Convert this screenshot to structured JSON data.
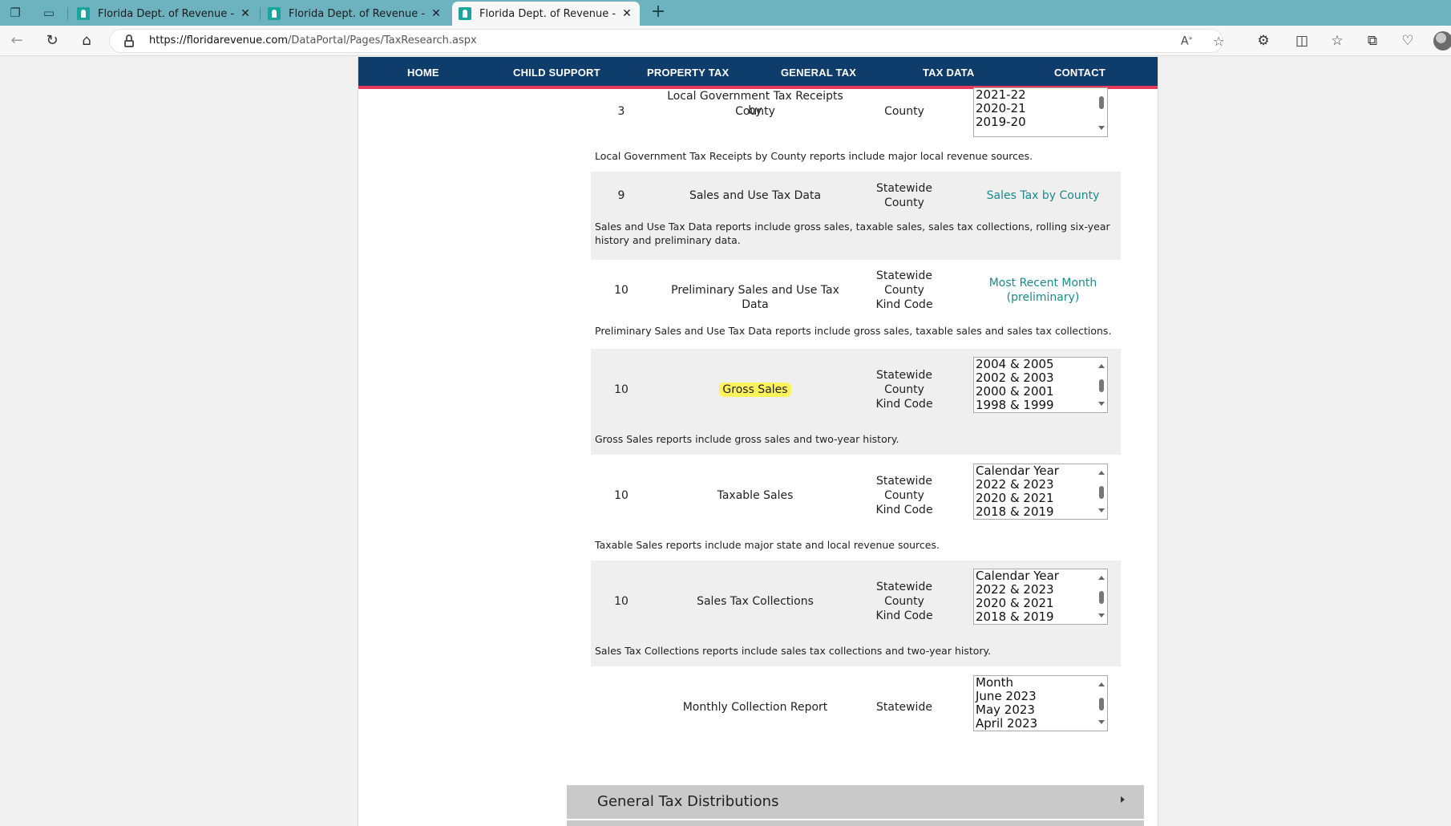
{
  "browser": {
    "tabs": [
      {
        "title": "Florida Dept. of Revenue - Home",
        "active": false
      },
      {
        "title": "Florida Dept. of Revenue - Home",
        "active": false
      },
      {
        "title": "Florida Dept. of Revenue - taxresearch",
        "active": true
      }
    ],
    "url_host": "https://floridarevenue.com",
    "url_path": "/DataPortal/Pages/TaxResearch.aspx"
  },
  "nav": {
    "items": [
      "HOME",
      "CHILD SUPPORT",
      "PROPERTY TAX",
      "GENERAL TAX",
      "TAX DATA",
      "CONTACT"
    ]
  },
  "rows": [
    {
      "number": "3",
      "name_line1": "Local Government Tax Receipts by",
      "name_line2": "County",
      "level1": "County",
      "options": [
        "2021-22",
        "2020-21",
        "2019-20"
      ],
      "description": "Local Government Tax Receipts by County reports include major local revenue sources."
    },
    {
      "number": "9",
      "name": "Sales and Use Tax Data",
      "level1": "Statewide",
      "level2": "County",
      "link": "Sales Tax by County",
      "description_line1": "Sales and Use Tax Data reports include gross sales, taxable sales, sales tax collections, rolling six-year",
      "description_line2": "history and preliminary data."
    },
    {
      "number": "10",
      "name": "Preliminary Sales and Use Tax Data",
      "level1": "Statewide",
      "level2": "County",
      "level3": "Kind Code",
      "link_line1": "Most Recent Month",
      "link_line2": "(preliminary)",
      "description": "Preliminary Sales and Use Tax Data reports include gross sales, taxable sales and sales tax collections."
    },
    {
      "number": "10",
      "name": "Gross Sales",
      "level1": "Statewide",
      "level2": "County",
      "level3": "Kind Code",
      "options": [
        "2004 & 2005",
        "2002 & 2003",
        "2000 & 2001",
        "1998 & 1999"
      ],
      "description": "Gross Sales reports include gross sales and two-year history."
    },
    {
      "number": "10",
      "name": "Taxable Sales",
      "level1": "Statewide",
      "level2": "County",
      "level3": "Kind Code",
      "options": [
        "Calendar Year",
        "2022 & 2023",
        "2020 & 2021",
        "2018 & 2019"
      ],
      "description": "Taxable Sales reports include major state and local revenue sources."
    },
    {
      "number": "10",
      "name": "Sales Tax Collections",
      "level1": "Statewide",
      "level2": "County",
      "level3": "Kind Code",
      "options": [
        "Calendar Year",
        "2022 & 2023",
        "2020 & 2021",
        "2018 & 2019"
      ],
      "description": "Sales Tax Collections reports include sales tax collections and two-year history."
    },
    {
      "name": "Monthly Collection Report",
      "level1": "Statewide",
      "options": [
        "Month",
        "June 2023",
        "May 2023",
        "April 2023"
      ]
    }
  ],
  "accordion": {
    "label": "General Tax Distributions"
  },
  "colors": {
    "nav_bg": "#0f3d6b",
    "nav_border": "#e8385b",
    "link": "#1b8a8a",
    "highlight": "#fff35c",
    "tabstrip": "#6cb3bf"
  }
}
